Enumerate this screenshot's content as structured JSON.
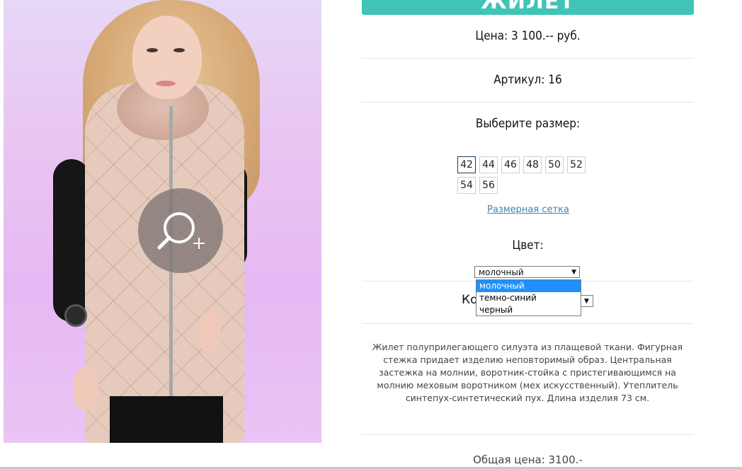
{
  "product": {
    "title": "ЖИЛЕТ",
    "price_text": "Цена: 3 100.-- руб.",
    "article_text": "Артикул: 16",
    "choose_size_text": "Выберите размер:",
    "sizes": [
      "42",
      "44",
      "46",
      "48",
      "50",
      "52",
      "54",
      "56"
    ],
    "selected_size": "42",
    "size_chart_link": "Размерная сетка",
    "color_label": "Цвет:",
    "color_selected": "молочный",
    "color_options": [
      "молочный",
      "темно-синий",
      "черный"
    ],
    "qty_label_visible": "Ко",
    "description": "Жилет полуприлегающего силуэта из плащевой ткани. Фигурная стежка придает изделию неповторимый образ. Центральная застежка на молнии, воротник-стойка с пристегивающимся на молнию меховым воротником (мех искусственный). Утеплитель синтепух-синтетический пух. Длина изделия 73 см.",
    "total_text": "Общая цена: 3100.-"
  },
  "icons": {
    "zoom": "zoom-in-icon",
    "dropdown_arrow": "caret-down-icon"
  },
  "colors": {
    "accent": "#3fc4b6",
    "link": "#3a84b9",
    "selected_option": "#1e90ff"
  }
}
